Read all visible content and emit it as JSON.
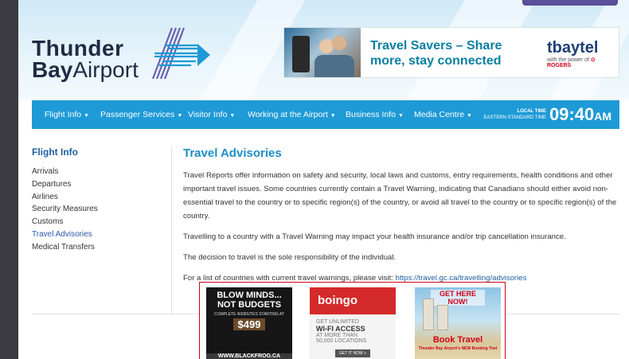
{
  "logo": {
    "word1": "Thunder",
    "word2_bold": "Bay",
    "word2_rest": "Airport"
  },
  "header_ad": {
    "headline_line1": "Travel Savers – Share",
    "headline_line2": "more, stay connected",
    "brand": "tbaytel",
    "tagline": "with the power of",
    "partner": "ROGERS"
  },
  "nav": {
    "items": [
      {
        "label": "Flight Info"
      },
      {
        "label": "Passenger Services"
      },
      {
        "label": "Visitor Info"
      },
      {
        "label": "Working at the Airport"
      },
      {
        "label": "Business Info"
      },
      {
        "label": "Media Centre"
      }
    ],
    "clock": {
      "label1": "LOCAL TIME",
      "label2": "EASTERN STANDARD TIME",
      "time": "09:40",
      "ampm": "AM"
    }
  },
  "sidebar": {
    "title": "Flight Info",
    "items": [
      {
        "label": "Arrivals"
      },
      {
        "label": "Departures"
      },
      {
        "label": "Airlines"
      },
      {
        "label": "Security Measures"
      },
      {
        "label": "Customs"
      },
      {
        "label": "Travel Advisories"
      },
      {
        "label": "Medical Transfers"
      }
    ],
    "active_index": 5
  },
  "content": {
    "title": "Travel Advisories",
    "p1": "Travel Reports offer information on safety and security, local laws and customs, entry requirements, health conditions and other important travel issues. Some countries currently contain a Travel Warning, indicating that Canadians should either avoid non-essential travel to the country or to specific region(s) of the country, or avoid all travel to the country or to specific region(s) of the country.",
    "p2": "Travelling to a country with a Travel Warning may impact your health insurance and/or trip cancellation insurance.",
    "p3": "The decision to travel is the sole responsibility of the individual.",
    "p4_prefix": "For a list of countries with current travel warnings, please visit: ",
    "p4_link": "https://travel.gc.ca/travelling/advisories"
  },
  "bottom_ads": {
    "ad1": {
      "line1": "BLOW MINDS...",
      "line2": "NOT BUDGETS",
      "sub": "COMPLETE WEBSITES STARTING AT",
      "price": "$499",
      "url": "WWW.BLACKFROG.CA"
    },
    "ad2": {
      "brand": "boingo",
      "l1": "GET UNLIMITED",
      "l2": "WI-FI ACCESS",
      "l3": "AT MORE THAN",
      "l4": "50,000 LOCATIONS",
      "cta": "GET IT NOW »"
    },
    "ad3": {
      "head": "GET HERE NOW!",
      "book": "Book Travel",
      "sub": "Thunder Bay Airport's NEW Booking Tool"
    }
  },
  "colors": {
    "nav_bg": "#1e9ad6",
    "title_blue": "#1e8fc8",
    "link_blue": "#1e5fa3",
    "ad_border": "#d0021b",
    "outer_bg": "#3a3a40"
  }
}
